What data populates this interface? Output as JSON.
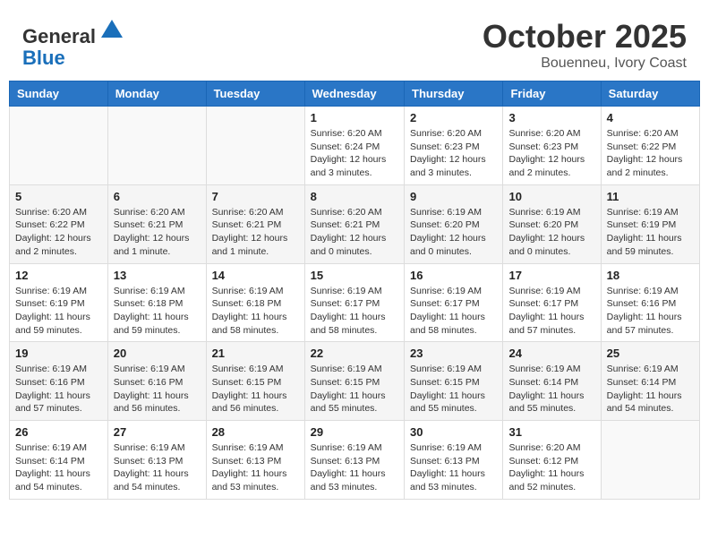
{
  "header": {
    "logo_general": "General",
    "logo_blue": "Blue",
    "month": "October 2025",
    "location": "Bouenneu, Ivory Coast"
  },
  "weekdays": [
    "Sunday",
    "Monday",
    "Tuesday",
    "Wednesday",
    "Thursday",
    "Friday",
    "Saturday"
  ],
  "weeks": [
    [
      {
        "day": "",
        "info": ""
      },
      {
        "day": "",
        "info": ""
      },
      {
        "day": "",
        "info": ""
      },
      {
        "day": "1",
        "info": "Sunrise: 6:20 AM\nSunset: 6:24 PM\nDaylight: 12 hours and 3 minutes."
      },
      {
        "day": "2",
        "info": "Sunrise: 6:20 AM\nSunset: 6:23 PM\nDaylight: 12 hours and 3 minutes."
      },
      {
        "day": "3",
        "info": "Sunrise: 6:20 AM\nSunset: 6:23 PM\nDaylight: 12 hours and 2 minutes."
      },
      {
        "day": "4",
        "info": "Sunrise: 6:20 AM\nSunset: 6:22 PM\nDaylight: 12 hours and 2 minutes."
      }
    ],
    [
      {
        "day": "5",
        "info": "Sunrise: 6:20 AM\nSunset: 6:22 PM\nDaylight: 12 hours and 2 minutes."
      },
      {
        "day": "6",
        "info": "Sunrise: 6:20 AM\nSunset: 6:21 PM\nDaylight: 12 hours and 1 minute."
      },
      {
        "day": "7",
        "info": "Sunrise: 6:20 AM\nSunset: 6:21 PM\nDaylight: 12 hours and 1 minute."
      },
      {
        "day": "8",
        "info": "Sunrise: 6:20 AM\nSunset: 6:21 PM\nDaylight: 12 hours and 0 minutes."
      },
      {
        "day": "9",
        "info": "Sunrise: 6:19 AM\nSunset: 6:20 PM\nDaylight: 12 hours and 0 minutes."
      },
      {
        "day": "10",
        "info": "Sunrise: 6:19 AM\nSunset: 6:20 PM\nDaylight: 12 hours and 0 minutes."
      },
      {
        "day": "11",
        "info": "Sunrise: 6:19 AM\nSunset: 6:19 PM\nDaylight: 11 hours and 59 minutes."
      }
    ],
    [
      {
        "day": "12",
        "info": "Sunrise: 6:19 AM\nSunset: 6:19 PM\nDaylight: 11 hours and 59 minutes."
      },
      {
        "day": "13",
        "info": "Sunrise: 6:19 AM\nSunset: 6:18 PM\nDaylight: 11 hours and 59 minutes."
      },
      {
        "day": "14",
        "info": "Sunrise: 6:19 AM\nSunset: 6:18 PM\nDaylight: 11 hours and 58 minutes."
      },
      {
        "day": "15",
        "info": "Sunrise: 6:19 AM\nSunset: 6:17 PM\nDaylight: 11 hours and 58 minutes."
      },
      {
        "day": "16",
        "info": "Sunrise: 6:19 AM\nSunset: 6:17 PM\nDaylight: 11 hours and 58 minutes."
      },
      {
        "day": "17",
        "info": "Sunrise: 6:19 AM\nSunset: 6:17 PM\nDaylight: 11 hours and 57 minutes."
      },
      {
        "day": "18",
        "info": "Sunrise: 6:19 AM\nSunset: 6:16 PM\nDaylight: 11 hours and 57 minutes."
      }
    ],
    [
      {
        "day": "19",
        "info": "Sunrise: 6:19 AM\nSunset: 6:16 PM\nDaylight: 11 hours and 57 minutes."
      },
      {
        "day": "20",
        "info": "Sunrise: 6:19 AM\nSunset: 6:16 PM\nDaylight: 11 hours and 56 minutes."
      },
      {
        "day": "21",
        "info": "Sunrise: 6:19 AM\nSunset: 6:15 PM\nDaylight: 11 hours and 56 minutes."
      },
      {
        "day": "22",
        "info": "Sunrise: 6:19 AM\nSunset: 6:15 PM\nDaylight: 11 hours and 55 minutes."
      },
      {
        "day": "23",
        "info": "Sunrise: 6:19 AM\nSunset: 6:15 PM\nDaylight: 11 hours and 55 minutes."
      },
      {
        "day": "24",
        "info": "Sunrise: 6:19 AM\nSunset: 6:14 PM\nDaylight: 11 hours and 55 minutes."
      },
      {
        "day": "25",
        "info": "Sunrise: 6:19 AM\nSunset: 6:14 PM\nDaylight: 11 hours and 54 minutes."
      }
    ],
    [
      {
        "day": "26",
        "info": "Sunrise: 6:19 AM\nSunset: 6:14 PM\nDaylight: 11 hours and 54 minutes."
      },
      {
        "day": "27",
        "info": "Sunrise: 6:19 AM\nSunset: 6:13 PM\nDaylight: 11 hours and 54 minutes."
      },
      {
        "day": "28",
        "info": "Sunrise: 6:19 AM\nSunset: 6:13 PM\nDaylight: 11 hours and 53 minutes."
      },
      {
        "day": "29",
        "info": "Sunrise: 6:19 AM\nSunset: 6:13 PM\nDaylight: 11 hours and 53 minutes."
      },
      {
        "day": "30",
        "info": "Sunrise: 6:19 AM\nSunset: 6:13 PM\nDaylight: 11 hours and 53 minutes."
      },
      {
        "day": "31",
        "info": "Sunrise: 6:20 AM\nSunset: 6:12 PM\nDaylight: 11 hours and 52 minutes."
      },
      {
        "day": "",
        "info": ""
      }
    ]
  ]
}
